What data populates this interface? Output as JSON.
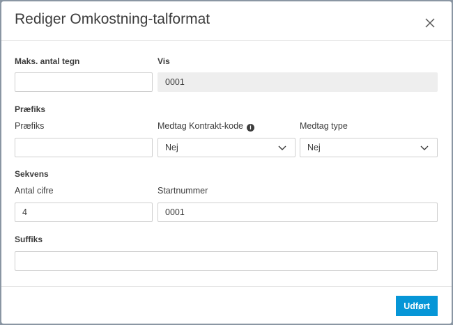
{
  "dialog": {
    "title": "Rediger Omkostning-talformat",
    "close_icon": "close-icon",
    "done_label": "Udført"
  },
  "fields": {
    "max_chars": {
      "label": "Maks. antal tegn",
      "value": ""
    },
    "preview": {
      "label": "Vis",
      "value": "0001"
    },
    "prefix_section": "Præfiks",
    "prefix": {
      "label": "Præfiks",
      "value": ""
    },
    "include_contract_code": {
      "label": "Medtag Kontrakt-kode",
      "value": "Nej",
      "info_icon": "info-icon"
    },
    "include_type": {
      "label": "Medtag type",
      "value": "Nej"
    },
    "sequence_section": "Sekvens",
    "digits": {
      "label": "Antal cifre",
      "value": "4"
    },
    "start_number": {
      "label": "Startnummer",
      "value": "0001"
    },
    "suffix_section": "Suffiks",
    "suffix": {
      "value": ""
    }
  },
  "colors": {
    "primary": "#0696d7"
  }
}
